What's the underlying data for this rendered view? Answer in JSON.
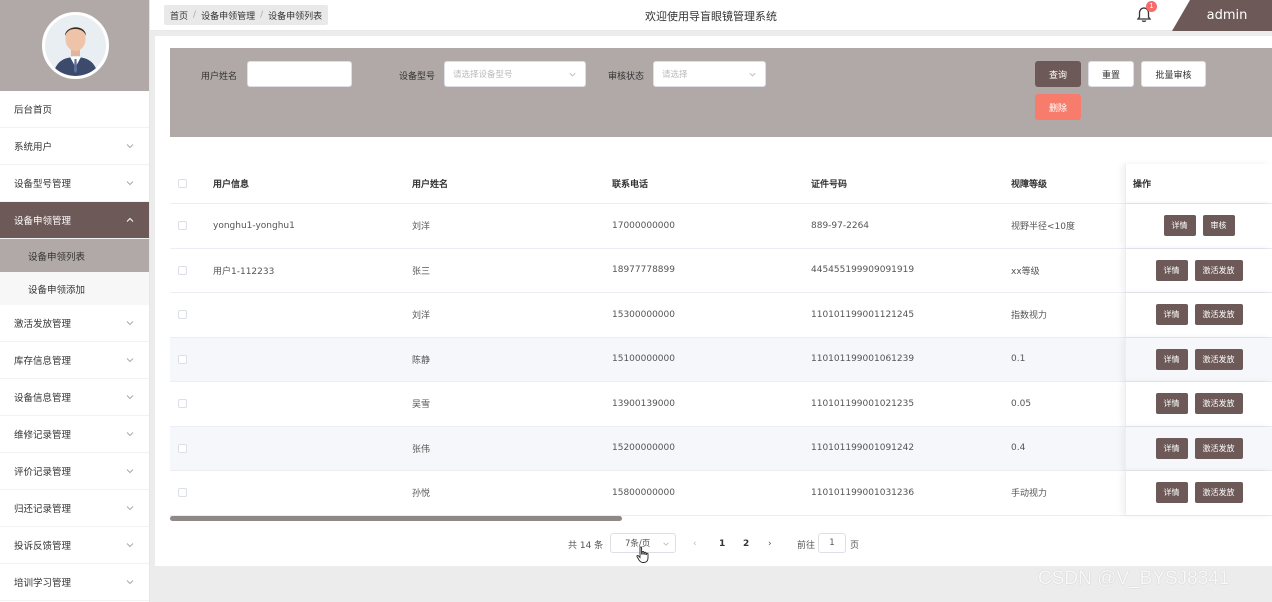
{
  "header": {
    "breadcrumb": [
      "首页",
      "设备申领管理",
      "设备申领列表"
    ],
    "title": "欢迎使用导盲眼镜管理系统",
    "notification_count": "1",
    "user": "admin"
  },
  "sidebar": {
    "items": [
      {
        "label": "后台首页",
        "has_arrow": false
      },
      {
        "label": "系统用户",
        "has_arrow": true
      },
      {
        "label": "设备型号管理",
        "has_arrow": true
      },
      {
        "label": "设备申领管理",
        "has_arrow": true,
        "active": true
      },
      {
        "label": "激活发放管理",
        "has_arrow": true
      },
      {
        "label": "库存信息管理",
        "has_arrow": true
      },
      {
        "label": "设备信息管理",
        "has_arrow": true
      },
      {
        "label": "维修记录管理",
        "has_arrow": true
      },
      {
        "label": "评价记录管理",
        "has_arrow": true
      },
      {
        "label": "归还记录管理",
        "has_arrow": true
      },
      {
        "label": "投诉反馈管理",
        "has_arrow": true
      },
      {
        "label": "培训学习管理",
        "has_arrow": true
      }
    ],
    "sub_items": [
      {
        "label": "设备申领列表",
        "active": true
      },
      {
        "label": "设备申领添加",
        "active": false
      }
    ]
  },
  "search": {
    "username_label": "用户姓名",
    "username_value": "",
    "model_label": "设备型号",
    "model_placeholder": "请选择设备型号",
    "status_label": "审核状态",
    "status_placeholder": "请选择",
    "query_button": "查询",
    "reset_button": "重置",
    "batch_review_button": "批量审核",
    "delete_button": "删除"
  },
  "table": {
    "columns": [
      "用户信息",
      "用户姓名",
      "联系电话",
      "证件号码",
      "视障等级",
      "操作"
    ],
    "rows": [
      {
        "info": "yonghu1-yonghu1",
        "name": "刘洋",
        "phone": "17000000000",
        "id": "889-97-2264",
        "level": "视野半径<10度",
        "actions": [
          "详情",
          "审核"
        ]
      },
      {
        "info": "用户1-112233",
        "name": "张三",
        "phone": "18977778899",
        "id": "445455199909091919",
        "level": "xx等级",
        "actions": [
          "详情",
          "激活发放"
        ]
      },
      {
        "info": "",
        "name": "刘洋",
        "phone": "15300000000",
        "id": "110101199001121245",
        "level": "指数视力",
        "actions": [
          "详情",
          "激活发放"
        ]
      },
      {
        "info": "",
        "name": "陈静",
        "phone": "15100000000",
        "id": "110101199001061239",
        "level": "0.1",
        "actions": [
          "详情",
          "激活发放"
        ]
      },
      {
        "info": "",
        "name": "吴雪",
        "phone": "13900139000",
        "id": "110101199001021235",
        "level": "0.05",
        "actions": [
          "详情",
          "激活发放"
        ]
      },
      {
        "info": "",
        "name": "张伟",
        "phone": "15200000000",
        "id": "110101199001091242",
        "level": "0.4",
        "actions": [
          "详情",
          "激活发放"
        ]
      },
      {
        "info": "",
        "name": "孙悦",
        "phone": "15800000000",
        "id": "110101199001031236",
        "level": "手动视力",
        "actions": [
          "详情",
          "激活发放"
        ]
      }
    ]
  },
  "pagination": {
    "total": "共 14 条",
    "page_size": "7条/页",
    "pages": [
      "1",
      "2"
    ],
    "goto_label": "前往",
    "goto_value": "1",
    "page_suffix": "页"
  },
  "watermark": "CSDN @V_BYSJ8341",
  "colors": {
    "accent": "#6d5a58",
    "panel": "#b0a9a8",
    "danger": "#f87c6c"
  }
}
